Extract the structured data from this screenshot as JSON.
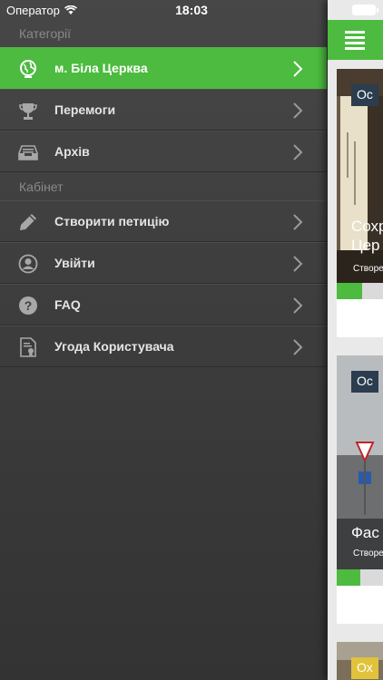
{
  "status_bar": {
    "carrier": "Оператор",
    "time": "18:03"
  },
  "menu": {
    "section_categories": "Категорії",
    "categories": [
      {
        "label": "м. Біла Церква",
        "icon": "globe-icon",
        "active": true
      },
      {
        "label": "Перемоги",
        "icon": "trophy-icon",
        "active": false
      },
      {
        "label": "Архів",
        "icon": "archive-tray-icon",
        "active": false
      }
    ],
    "section_cabinet": "Кабінет",
    "cabinet": [
      {
        "label": "Створити петицію",
        "icon": "pencil-icon"
      },
      {
        "label": "Увійти",
        "icon": "user-icon"
      },
      {
        "label": "FAQ",
        "icon": "question-icon"
      },
      {
        "label": "Угода Користувача",
        "icon": "document-icon"
      }
    ]
  },
  "content": {
    "cards": [
      {
        "badge": "Ос",
        "title_line1": "Сохр",
        "title_line2": "Цер",
        "subtitle": "Створе",
        "progress": 0.55
      },
      {
        "badge": "Ос",
        "title_line1": "Фас",
        "title_line2": "",
        "subtitle": "Створе",
        "progress": 0.5
      },
      {
        "badge": "Ох",
        "title_line1": "",
        "title_line2": "",
        "subtitle": "",
        "progress": 0
      }
    ]
  },
  "colors": {
    "accent_green": "#4cbb3f",
    "menu_bg": "#3e3e3e",
    "badge_dark": "#2b3d4f",
    "badge_yellow": "#e0c33a"
  }
}
